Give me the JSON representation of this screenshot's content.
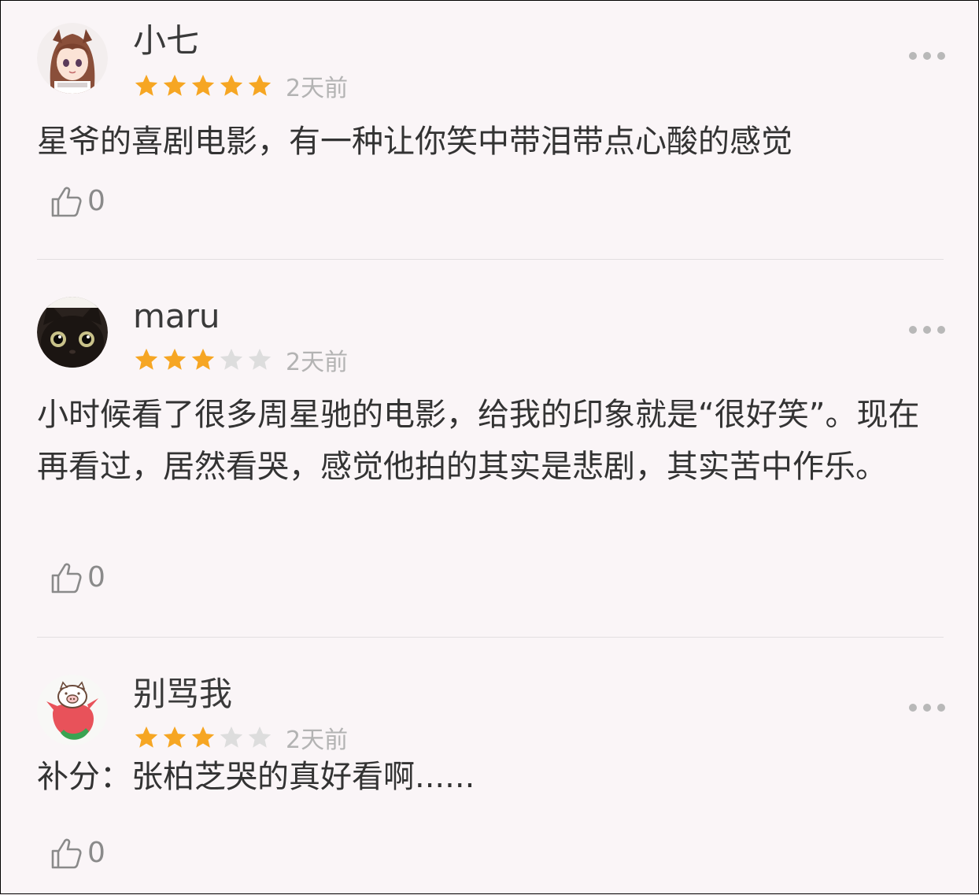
{
  "comments": [
    {
      "username": "小七",
      "rating": 5,
      "max_rating": 5,
      "time": "2天前",
      "text": "星爷的喜剧电影，有一种让你笑中带泪带点心酸的感觉",
      "likes": "0",
      "avatar_icon": "anime-girl-avatar-icon"
    },
    {
      "username": "maru",
      "rating": 3,
      "max_rating": 5,
      "time": "2天前",
      "text": "小时候看了很多周星驰的电影，给我的印象就是“很好笑”。现在再看过，居然看哭，感觉他拍的其实是悲剧，其实苦中作乐。",
      "likes": "0",
      "avatar_icon": "black-cat-avatar-icon"
    },
    {
      "username": "别骂我",
      "rating": 3,
      "max_rating": 5,
      "time": "2天前",
      "text": "补分：张柏芝哭的真好看啊......",
      "likes": "0",
      "avatar_icon": "pig-avatar-icon"
    }
  ],
  "colors": {
    "background": "#faf5f7",
    "star_filled": "#f6a623",
    "star_empty": "#dddddd",
    "muted_text": "#b3b3b3",
    "body_text": "#333333"
  }
}
